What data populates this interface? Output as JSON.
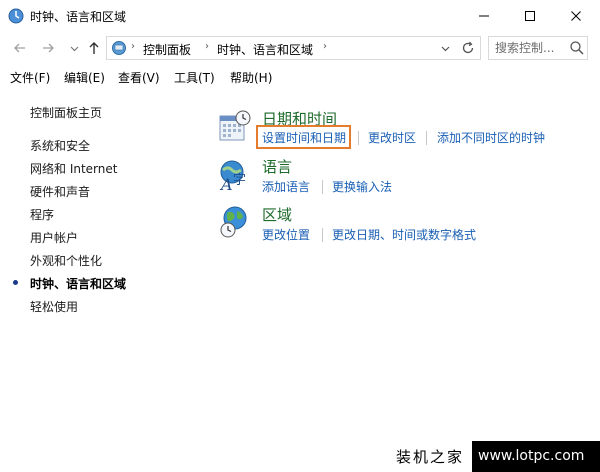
{
  "window": {
    "title": "时钟、语言和区域"
  },
  "address": {
    "breadcrumbs": [
      "控制面板",
      "时钟、语言和区域"
    ],
    "search_placeholder": "搜索控制..."
  },
  "menu": {
    "items": [
      "文件(F)",
      "编辑(E)",
      "查看(V)",
      "工具(T)",
      "帮助(H)"
    ]
  },
  "sidebar": {
    "home": "控制面板主页",
    "items": [
      "系统和安全",
      "网络和 Internet",
      "硬件和声音",
      "程序",
      "用户帐户",
      "外观和个性化",
      "时钟、语言和区域",
      "轻松使用"
    ],
    "active_index": 6
  },
  "categories": {
    "datetime": {
      "title": "日期和时间",
      "links": [
        "设置时间和日期",
        "更改时区",
        "添加不同时区的时钟"
      ]
    },
    "language": {
      "title": "语言",
      "links": [
        "添加语言",
        "更换输入法"
      ]
    },
    "region": {
      "title": "区域",
      "links": [
        "更改位置",
        "更改日期、时间或数字格式"
      ]
    }
  },
  "watermark": {
    "text": "装机之家",
    "url": "www.lotpc.com"
  },
  "colors": {
    "link": "#1a5fb4",
    "category_title": "#1d6b2b",
    "highlight_border": "#e57b2c"
  }
}
